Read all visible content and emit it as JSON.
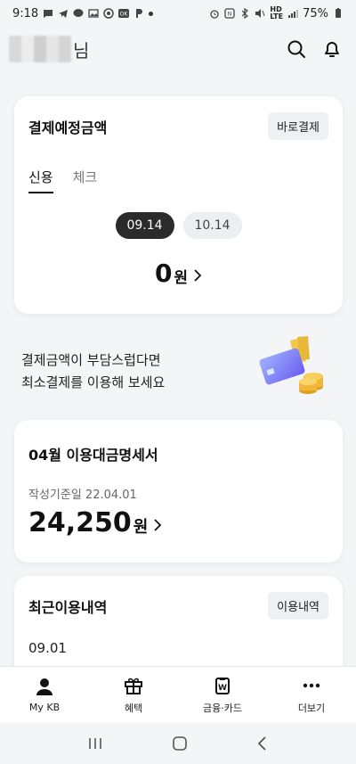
{
  "status_bar": {
    "time": "9:18",
    "battery": "75%",
    "net_hd": "HD",
    "net_lte": "LTE"
  },
  "header": {
    "name_suffix": "님"
  },
  "payment": {
    "title": "결제예정금액",
    "action_label": "바로결제",
    "tabs": [
      {
        "label": "신용"
      },
      {
        "label": "체크"
      }
    ],
    "dates": [
      {
        "label": "09.14"
      },
      {
        "label": "10.14"
      }
    ],
    "amount": "0",
    "unit": "원"
  },
  "promo": {
    "line1": "결제금액이 부담스럽다면",
    "line2": "최소결제를 이용해 보세요"
  },
  "statement": {
    "title": "04월 이용대금명세서",
    "date_label": "작성기준일 22.04.01",
    "amount": "24,250",
    "unit": "원"
  },
  "recent": {
    "title": "최근이용내역",
    "action_label": "이용내역",
    "first_date": "09.01"
  },
  "bottom_nav": [
    {
      "label": "My KB",
      "icon": "person-icon"
    },
    {
      "label": "혜택",
      "icon": "gift-icon"
    },
    {
      "label": "금융·카드",
      "icon": "won-card-icon"
    },
    {
      "label": "더보기",
      "icon": "more-icon"
    }
  ],
  "colors": {
    "accent_dark": "#2b2b2b",
    "background": "#f4f5f7",
    "chip": "#eef0f4"
  }
}
